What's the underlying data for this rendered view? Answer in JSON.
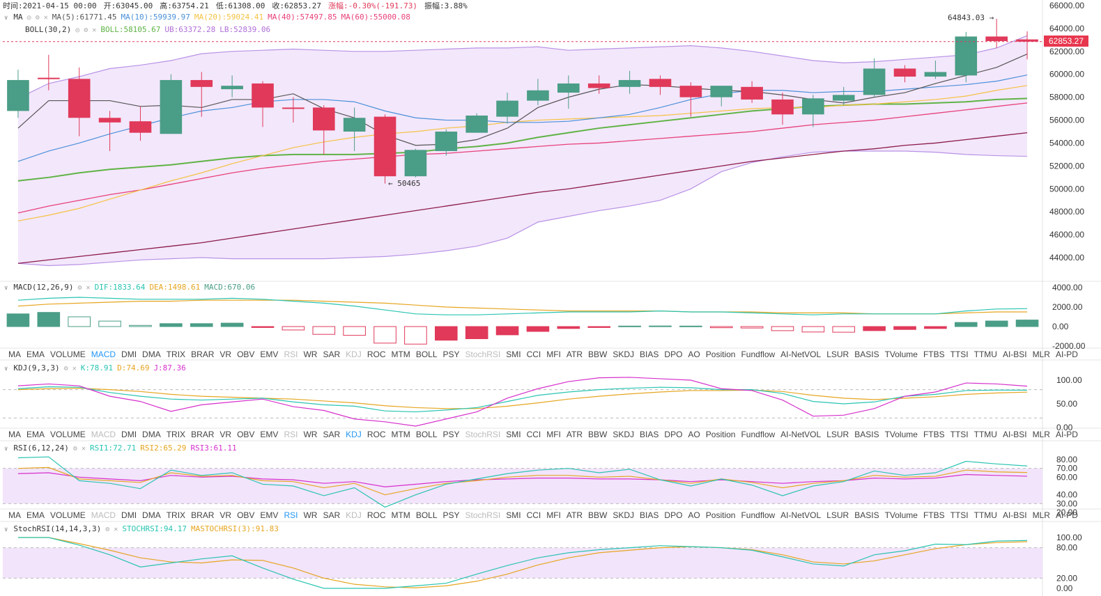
{
  "ohlc": {
    "time": "时间:2021-04-15 00:00",
    "open": "开:63045.00",
    "high": "高:63754.21",
    "low": "低:61308.00",
    "close": "收:62853.27",
    "change": "涨幅:-0.30%(-191.73)",
    "amplitude": "振幅:3.88%"
  },
  "legend_ma": {
    "name": "MA",
    "ma5": "MA(5):61771.45",
    "ma10": "MA(10):59939.97",
    "ma20": "MA(20):59024.41",
    "ma40": "MA(40):57497.85",
    "ma60": "MA(60):55000.08"
  },
  "legend_boll": {
    "name": "BOLL(30,2)",
    "boll": "BOLL:58105.67",
    "ub": "UB:63372.28",
    "lb": "LB:52839.06"
  },
  "legend_macd": {
    "name": "MACD(12,26,9)",
    "dif": "DIF:1833.64",
    "dea": "DEA:1498.61",
    "macd": "MACD:670.06"
  },
  "legend_kdj": {
    "name": "KDJ(9,3,3)",
    "k": "K:78.91",
    "d": "D:74.69",
    "j": "J:87.36"
  },
  "legend_rsi": {
    "name": "RSI(6,12,24)",
    "r1": "RSI1:72.71",
    "r2": "RSI2:65.29",
    "r3": "RSI3:61.11"
  },
  "legend_stoch": {
    "name": "StochRSI(14,14,3,3)",
    "s": "STOCHRSI:94.17",
    "m": "MASTOCHRSI(3):91.83"
  },
  "price_tag": "62853.27",
  "high_label": "64843.03 →",
  "low_label": "← 50465",
  "tabs": [
    "MA",
    "EMA",
    "VOLUME",
    "MACD",
    "DMI",
    "DMA",
    "TRIX",
    "BRAR",
    "VR",
    "OBV",
    "EMV",
    "RSI",
    "WR",
    "SAR",
    "KDJ",
    "ROC",
    "MTM",
    "BOLL",
    "PSY",
    "StochRSI",
    "SMI",
    "CCI",
    "MFI",
    "ATR",
    "BBW",
    "SKDJ",
    "BIAS",
    "DPO",
    "AO",
    "Position",
    "Fundflow",
    "AI-NetVOL",
    "LSUR",
    "BASIS",
    "TVolume",
    "FTBS",
    "TTSI",
    "TTMU",
    "AI-BSI",
    "MLR",
    "AI-PD"
  ],
  "tab_states": {
    "macd_bar": {
      "active": "MACD",
      "disabled": [
        "RSI",
        "KDJ",
        "StochRSI"
      ]
    },
    "kdj_bar": {
      "active": "KDJ",
      "disabled": [
        "MACD",
        "RSI",
        "StochRSI"
      ]
    },
    "rsi_bar": {
      "active": "RSI",
      "disabled": [
        "MACD",
        "KDJ",
        "StochRSI"
      ]
    }
  },
  "colors": {
    "up": "#4a9d86",
    "down": "#e0395a",
    "ma5": "#555555",
    "ma10": "#4a90d9",
    "ma20": "#f5c242",
    "ma40": "#5fb345",
    "ma60": "#e8417a",
    "ma_long": "#8b1a4a",
    "boll_band": "#b892e6",
    "boll_fill": "#f2e4fb"
  },
  "chart_data": [
    {
      "type": "candlestick",
      "title": "",
      "ylim": [
        42000,
        66000
      ],
      "y_ticks": [
        "66000.00",
        "64000.00",
        "62000.00",
        "60000.00",
        "58000.00",
        "56000.00",
        "54000.00",
        "52000.00",
        "50000.00",
        "48000.00",
        "46000.00",
        "44000.00"
      ],
      "candles": [
        {
          "o": 56800,
          "h": 60400,
          "l": 56200,
          "c": 59500
        },
        {
          "o": 59700,
          "h": 61700,
          "l": 58600,
          "c": 59600
        },
        {
          "o": 59600,
          "h": 60600,
          "l": 54600,
          "c": 56200
        },
        {
          "o": 56200,
          "h": 56800,
          "l": 53300,
          "c": 55800
        },
        {
          "o": 55900,
          "h": 57200,
          "l": 54200,
          "c": 54900
        },
        {
          "o": 54800,
          "h": 60000,
          "l": 54800,
          "c": 59500
        },
        {
          "o": 59500,
          "h": 60200,
          "l": 56300,
          "c": 58900
        },
        {
          "o": 58700,
          "h": 59900,
          "l": 58000,
          "c": 59000
        },
        {
          "o": 59200,
          "h": 59400,
          "l": 55400,
          "c": 57100
        },
        {
          "o": 57100,
          "h": 58000,
          "l": 55800,
          "c": 57000
        },
        {
          "o": 57100,
          "h": 57300,
          "l": 53000,
          "c": 55100
        },
        {
          "o": 55000,
          "h": 57100,
          "l": 53300,
          "c": 56200
        },
        {
          "o": 56300,
          "h": 56500,
          "l": 50465,
          "c": 51100
        },
        {
          "o": 51100,
          "h": 53500,
          "l": 51000,
          "c": 53400
        },
        {
          "o": 53300,
          "h": 55200,
          "l": 52900,
          "c": 55000
        },
        {
          "o": 54900,
          "h": 56600,
          "l": 54900,
          "c": 56400
        },
        {
          "o": 56300,
          "h": 58400,
          "l": 55700,
          "c": 57700
        },
        {
          "o": 57700,
          "h": 59600,
          "l": 57300,
          "c": 58600
        },
        {
          "o": 58400,
          "h": 59900,
          "l": 57000,
          "c": 59200
        },
        {
          "o": 59200,
          "h": 59900,
          "l": 58300,
          "c": 58800
        },
        {
          "o": 58900,
          "h": 60300,
          "l": 58300,
          "c": 59500
        },
        {
          "o": 59600,
          "h": 59900,
          "l": 58200,
          "c": 58900
        },
        {
          "o": 59000,
          "h": 59300,
          "l": 56300,
          "c": 58000
        },
        {
          "o": 58000,
          "h": 59000,
          "l": 57200,
          "c": 59000
        },
        {
          "o": 58900,
          "h": 59400,
          "l": 57500,
          "c": 57800
        },
        {
          "o": 57800,
          "h": 58400,
          "l": 55600,
          "c": 56500
        },
        {
          "o": 56500,
          "h": 58200,
          "l": 55400,
          "c": 57900
        },
        {
          "o": 57700,
          "h": 58900,
          "l": 57300,
          "c": 58200
        },
        {
          "o": 58200,
          "h": 61400,
          "l": 58000,
          "c": 60500
        },
        {
          "o": 60500,
          "h": 60800,
          "l": 59300,
          "c": 59800
        },
        {
          "o": 59800,
          "h": 61200,
          "l": 59600,
          "c": 60200
        },
        {
          "o": 59900,
          "h": 63700,
          "l": 59300,
          "c": 63300
        },
        {
          "o": 63300,
          "h": 64843,
          "l": 62300,
          "c": 62900
        },
        {
          "o": 63045,
          "h": 63754,
          "l": 61308,
          "c": 62853
        }
      ],
      "ma5": [
        55300,
        57700,
        57700,
        57700,
        57200,
        57300,
        57100,
        57800,
        57800,
        58300,
        57000,
        56200,
        54700,
        53800,
        53900,
        54300,
        55300,
        57100,
        58000,
        58700,
        59100,
        59000,
        58800,
        58600,
        58500,
        58200,
        57800,
        57500,
        58000,
        58400,
        59200,
        59900,
        60600,
        61771
      ],
      "ma10": [
        52400,
        53300,
        54000,
        54800,
        55500,
        56200,
        56800,
        57100,
        57600,
        57800,
        57800,
        57600,
        56800,
        56200,
        56000,
        56000,
        55800,
        55800,
        55900,
        56200,
        56500,
        57100,
        57800,
        58300,
        58600,
        58600,
        58400,
        58500,
        58500,
        58700,
        58900,
        59100,
        59400,
        59940
      ],
      "ma20": [
        47200,
        47700,
        48300,
        49100,
        49900,
        50700,
        51400,
        52200,
        52900,
        53600,
        54100,
        54500,
        54800,
        55000,
        55300,
        55500,
        55800,
        56000,
        56100,
        56200,
        56300,
        56400,
        56600,
        56800,
        57000,
        57100,
        57100,
        57300,
        57400,
        57600,
        57800,
        58100,
        58600,
        59024
      ],
      "ma40": [
        50700,
        51000,
        51400,
        51700,
        51900,
        52100,
        52400,
        52700,
        52900,
        53000,
        53000,
        53000,
        53100,
        53200,
        53500,
        53700,
        54000,
        54500,
        54900,
        55300,
        55600,
        55900,
        56200,
        56500,
        56800,
        57000,
        57200,
        57300,
        57400,
        57400,
        57500,
        57600,
        57800,
        57898
      ],
      "ma60": [
        47900,
        48500,
        49000,
        49500,
        49900,
        50400,
        50900,
        51400,
        51800,
        52100,
        52400,
        52600,
        52800,
        53000,
        53100,
        53300,
        53500,
        53700,
        53900,
        54000,
        54200,
        54400,
        54600,
        54800,
        55000,
        55300,
        55600,
        55800,
        56000,
        56300,
        56600,
        56900,
        57200,
        57500
      ],
      "ma_long": [
        43500,
        43800,
        44100,
        44400,
        44700,
        45000,
        45300,
        45700,
        46100,
        46500,
        46900,
        47300,
        47700,
        48100,
        48500,
        48900,
        49300,
        49700,
        50000,
        50400,
        50800,
        51200,
        51600,
        52000,
        52400,
        52700,
        53000,
        53300,
        53500,
        53800,
        54000,
        54300,
        54600,
        54900
      ],
      "boll_ub": [
        57900,
        59200,
        59800,
        60500,
        60800,
        61200,
        61800,
        62000,
        62100,
        62200,
        62100,
        62000,
        62000,
        62100,
        62200,
        62300,
        62300,
        62400,
        62100,
        62200,
        62300,
        62400,
        62500,
        62300,
        62000,
        61600,
        61200,
        61000,
        61100,
        61300,
        61500,
        61700,
        62300,
        63372
      ],
      "boll_lb": [
        43500,
        43300,
        43400,
        43600,
        43800,
        43900,
        44000,
        43900,
        43900,
        43900,
        43900,
        44000,
        44100,
        44300,
        44600,
        45000,
        45700,
        47100,
        47600,
        48100,
        48500,
        49000,
        50000,
        51500,
        52300,
        52800,
        53200,
        53300,
        53300,
        53300,
        53200,
        53000,
        52900,
        52839
      ],
      "last_price": 62853.27
    },
    {
      "type": "macd",
      "ylim": [
        -2000,
        4000
      ],
      "y_ticks": [
        "4000.00",
        "2000.00",
        "0.00",
        "-2000.00"
      ],
      "dif": [
        2700,
        2900,
        3000,
        2900,
        2800,
        2800,
        2800,
        2900,
        2800,
        2600,
        2400,
        2100,
        1700,
        1300,
        1200,
        1200,
        1300,
        1400,
        1500,
        1500,
        1500,
        1600,
        1500,
        1500,
        1400,
        1300,
        1200,
        1300,
        1300,
        1300,
        1300,
        1600,
        1800,
        1834
      ],
      "dea": [
        2100,
        2300,
        2400,
        2500,
        2600,
        2600,
        2700,
        2700,
        2700,
        2700,
        2600,
        2500,
        2400,
        2200,
        2000,
        1900,
        1800,
        1700,
        1600,
        1600,
        1600,
        1600,
        1500,
        1500,
        1500,
        1400,
        1400,
        1400,
        1300,
        1300,
        1300,
        1400,
        1500,
        1499
      ],
      "hist": [
        1300,
        1450,
        1000,
        560,
        120,
        300,
        300,
        350,
        -100,
        -350,
        -800,
        -900,
        -1700,
        -1800,
        -1400,
        -1250,
        -850,
        -500,
        -200,
        -100,
        50,
        60,
        50,
        -120,
        -150,
        -420,
        -560,
        -580,
        -420,
        -300,
        -200,
        420,
        570,
        670
      ]
    },
    {
      "type": "kdj",
      "ylim": [
        -10,
        120
      ],
      "y_ticks": [
        "100.00",
        "50.00",
        "0.00"
      ],
      "k": [
        82,
        86,
        85,
        74,
        66,
        60,
        58,
        60,
        62,
        54,
        48,
        45,
        35,
        33,
        37,
        42,
        55,
        68,
        75,
        80,
        83,
        85,
        84,
        80,
        80,
        72,
        55,
        50,
        54,
        66,
        70,
        78,
        79,
        78.91
      ],
      "d": [
        80,
        82,
        83,
        80,
        76,
        70,
        66,
        64,
        62,
        60,
        56,
        52,
        46,
        42,
        40,
        40,
        45,
        52,
        60,
        66,
        71,
        75,
        78,
        78,
        79,
        76,
        68,
        62,
        59,
        62,
        65,
        70,
        73,
        74.69
      ],
      "j": [
        88,
        92,
        88,
        66,
        55,
        34,
        48,
        54,
        60,
        44,
        36,
        18,
        12,
        3,
        18,
        33,
        62,
        82,
        97,
        105,
        106,
        103,
        100,
        82,
        78,
        58,
        24,
        26,
        40,
        66,
        75,
        94,
        92,
        87.36
      ]
    },
    {
      "type": "rsi",
      "ylim": [
        20,
        85
      ],
      "y_ticks": [
        "80.00",
        "70.00",
        "60.00",
        "40.00",
        "30.00",
        "20.00"
      ],
      "rsi1": [
        82,
        83,
        56,
        53,
        47,
        68,
        62,
        65,
        52,
        50,
        39,
        48,
        26,
        40,
        52,
        58,
        64,
        68,
        70,
        65,
        69,
        57,
        50,
        58,
        51,
        39,
        50,
        55,
        67,
        62,
        65,
        78,
        75,
        72.71
      ],
      "rsi2": [
        70,
        71,
        58,
        56,
        54,
        65,
        61,
        62,
        56,
        55,
        48,
        53,
        40,
        47,
        53,
        56,
        60,
        62,
        62,
        60,
        61,
        57,
        53,
        58,
        54,
        48,
        53,
        56,
        62,
        60,
        61,
        68,
        66,
        65.29
      ],
      "rsi3": [
        64,
        65,
        60,
        58,
        56,
        62,
        60,
        61,
        58,
        57,
        53,
        55,
        49,
        52,
        55,
        57,
        58,
        59,
        59,
        58,
        58,
        57,
        55,
        57,
        55,
        53,
        55,
        56,
        59,
        58,
        59,
        63,
        62,
        61.11
      ]
    },
    {
      "type": "stochrsi",
      "ylim": [
        -5,
        110
      ],
      "y_ticks": [
        "100.00",
        "80.00",
        "20.00",
        "0.00"
      ],
      "stochrsi": [
        100,
        100,
        85,
        66,
        42,
        50,
        58,
        64,
        40,
        18,
        0,
        0,
        0,
        5,
        10,
        28,
        45,
        60,
        70,
        76,
        80,
        84,
        82,
        80,
        75,
        62,
        48,
        44,
        66,
        74,
        87,
        86,
        93,
        94.17
      ],
      "mastochrsi": [
        100,
        100,
        88,
        75,
        60,
        52,
        50,
        56,
        55,
        40,
        20,
        8,
        3,
        1,
        5,
        14,
        28,
        46,
        60,
        70,
        75,
        80,
        82,
        80,
        76,
        66,
        52,
        48,
        54,
        66,
        78,
        86,
        90,
        91.83
      ]
    }
  ]
}
